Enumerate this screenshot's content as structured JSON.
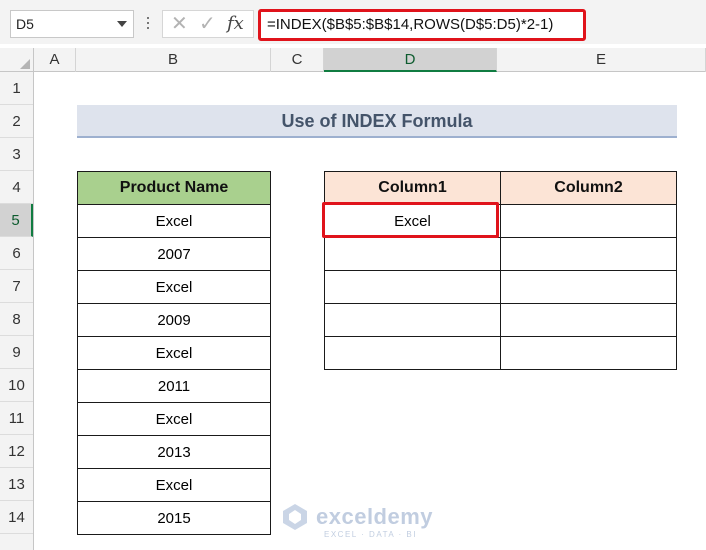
{
  "formula_bar": {
    "name_box": "D5",
    "cancel_glyph": "✕",
    "enter_glyph": "✓",
    "fx_glyph": "fx",
    "formula": "=INDEX($B$5:$B$14,ROWS(D$5:D5)*2-1)"
  },
  "grid": {
    "columns": [
      {
        "label": "A",
        "selected": false
      },
      {
        "label": "B",
        "selected": false
      },
      {
        "label": "C",
        "selected": false
      },
      {
        "label": "D",
        "selected": true
      },
      {
        "label": "E",
        "selected": false
      }
    ],
    "rows": [
      "1",
      "2",
      "3",
      "4",
      "5",
      "6",
      "7",
      "8",
      "9",
      "10",
      "11",
      "12",
      "13",
      "14"
    ],
    "selected_row": "5"
  },
  "sheet": {
    "title": "Use of INDEX Formula",
    "product_table": {
      "header": "Product Name",
      "values": [
        "Excel",
        "2007",
        "Excel",
        "2009",
        "Excel",
        "2011",
        "Excel",
        "2013",
        "Excel",
        "2015"
      ]
    },
    "result_table": {
      "headers": [
        "Column1",
        "Column2"
      ],
      "rows": [
        [
          "Excel",
          ""
        ],
        [
          "",
          ""
        ],
        [
          "",
          ""
        ],
        [
          "",
          ""
        ],
        [
          "",
          ""
        ]
      ]
    }
  },
  "watermark": {
    "name": "exceldemy",
    "tagline": "EXCEL · DATA · BI"
  },
  "colors": {
    "accent_red": "#e0131b",
    "product_header": "#a9d08e",
    "column_header": "#fce4d6",
    "title_band": "#dee3ed",
    "selection_green": "#107c41"
  }
}
